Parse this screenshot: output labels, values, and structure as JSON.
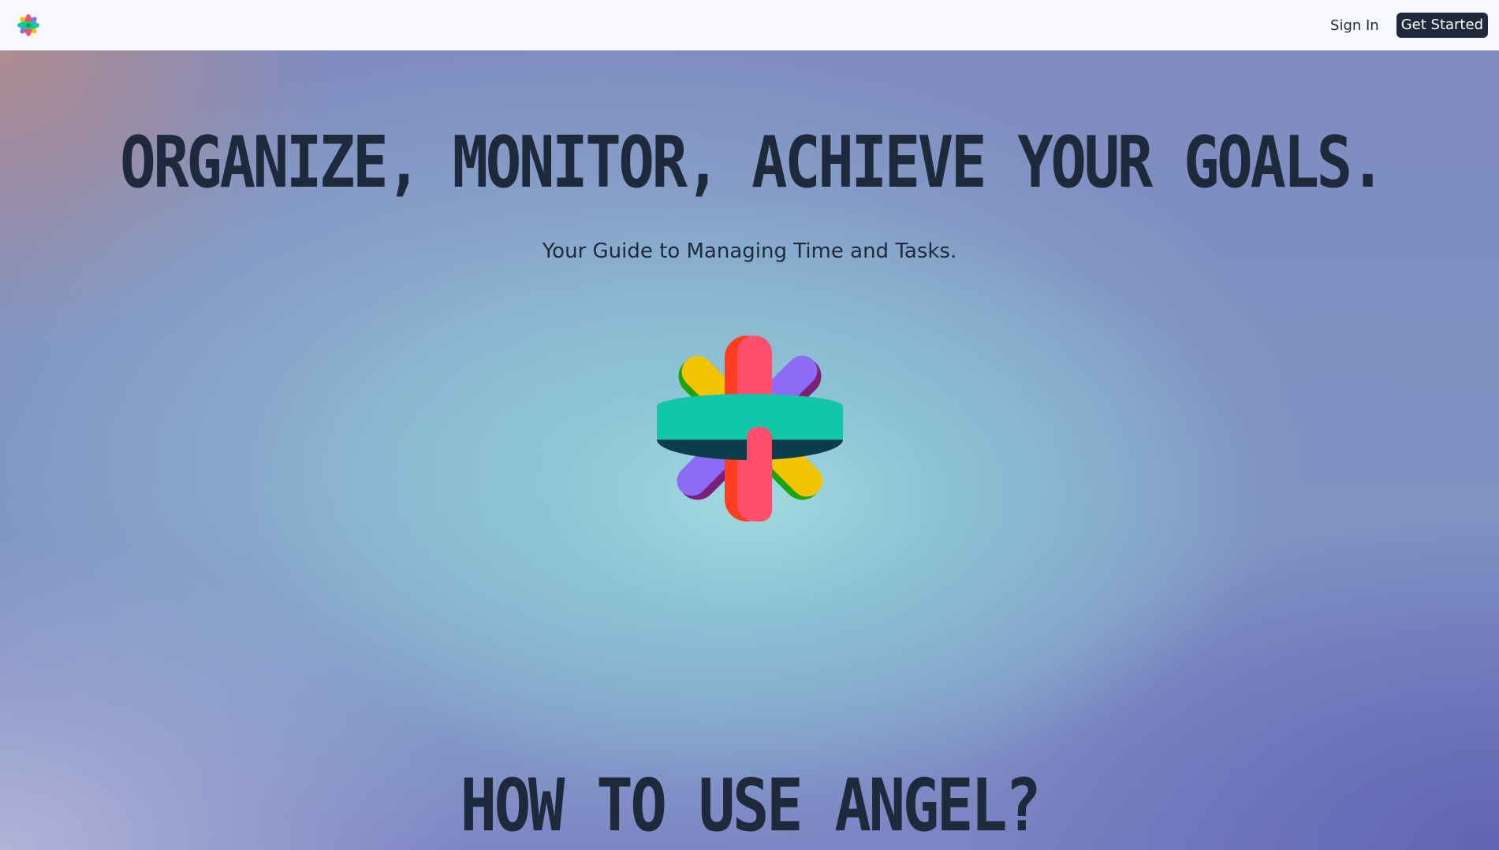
{
  "nav": {
    "logo_icon": "rainbow-flower-icon",
    "sign_in_label": "Sign In",
    "get_started_label": "Get Started"
  },
  "hero": {
    "title": "ORGANIZE, MONITOR, ACHIEVE YOUR GOALS.",
    "subtitle": "Your Guide to Managing Time and Tasks.",
    "illustration_icon": "rainbow-ring-flower-icon"
  },
  "section": {
    "title": "HOW TO USE ANGEL?"
  },
  "colors": {
    "nav_bg": "#f8f9fc",
    "text_dark": "#1e2a3b",
    "button_bg": "#1e2a3b",
    "ring_teal": "#12c7a9",
    "ring_pink": "#ff4f6d",
    "ring_red": "#ff3d1f",
    "ring_yellow": "#f2c500",
    "ring_purple": "#8c6cf5",
    "ring_green": "#1aa312"
  }
}
